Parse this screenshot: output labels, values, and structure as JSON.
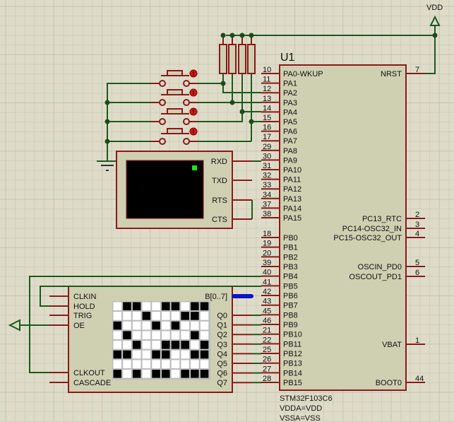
{
  "power": {
    "vdd_label": "VDD"
  },
  "u1": {
    "ref": "U1",
    "part": "STM32F103C6",
    "note1": "VDDA=VDD",
    "note2": "VSSA=VSS",
    "left_pins": [
      {
        "name": "PA0-WKUP",
        "num": "10"
      },
      {
        "name": "PA1",
        "num": "11"
      },
      {
        "name": "PA2",
        "num": "12"
      },
      {
        "name": "PA3",
        "num": "13"
      },
      {
        "name": "PA4",
        "num": "14"
      },
      {
        "name": "PA5",
        "num": "15"
      },
      {
        "name": "PA6",
        "num": "16"
      },
      {
        "name": "PA7",
        "num": "17"
      },
      {
        "name": "PA8",
        "num": "29"
      },
      {
        "name": "PA9",
        "num": "30"
      },
      {
        "name": "PA10",
        "num": "31"
      },
      {
        "name": "PA11",
        "num": "32"
      },
      {
        "name": "PA12",
        "num": "33"
      },
      {
        "name": "PA13",
        "num": "34"
      },
      {
        "name": "PA14",
        "num": "37"
      },
      {
        "name": "PA15",
        "num": "38"
      },
      {
        "name": "PB0",
        "num": "18"
      },
      {
        "name": "PB1",
        "num": "19"
      },
      {
        "name": "PB2",
        "num": "20"
      },
      {
        "name": "PB3",
        "num": "39"
      },
      {
        "name": "PB4",
        "num": "40"
      },
      {
        "name": "PB5",
        "num": "41"
      },
      {
        "name": "PB6",
        "num": "42"
      },
      {
        "name": "PB7",
        "num": "43"
      },
      {
        "name": "PB8",
        "num": "45"
      },
      {
        "name": "PB9",
        "num": "46"
      },
      {
        "name": "PB10",
        "num": "21"
      },
      {
        "name": "PB11",
        "num": "22"
      },
      {
        "name": "PB12",
        "num": "25"
      },
      {
        "name": "PB13",
        "num": "26"
      },
      {
        "name": "PB14",
        "num": "27"
      },
      {
        "name": "PB15",
        "num": "28"
      }
    ],
    "right_pins": [
      {
        "name": "NRST",
        "num": "7",
        "row": 0
      },
      {
        "name": "PC13_RTC",
        "num": "2",
        "row": 15
      },
      {
        "name": "PC14-OSC32_IN",
        "num": "3",
        "row": 16
      },
      {
        "name": "PC15-OSC32_OUT",
        "num": "4",
        "row": 17
      },
      {
        "name": "OSCIN_PD0",
        "num": "5",
        "row": 20
      },
      {
        "name": "OSCOUT_PD1",
        "num": "6",
        "row": 21
      },
      {
        "name": "VBAT",
        "num": "1",
        "row": 28
      },
      {
        "name": "BOOT0",
        "num": "44",
        "row": 32
      }
    ]
  },
  "terminal": {
    "pins": [
      "RXD",
      "TXD",
      "RTS",
      "CTS"
    ]
  },
  "pattern_gen": {
    "left_pins": [
      "CLKIN",
      "HOLD",
      "TRIG",
      "OE",
      "CLKOUT",
      "CASCADE"
    ],
    "bus_label": "B[0..7]",
    "right_pins": [
      "Q0",
      "Q1",
      "Q2",
      "Q3",
      "Q4",
      "Q5",
      "Q6",
      "Q7"
    ],
    "grid": [
      [
        0,
        1,
        1,
        0,
        0,
        1,
        1,
        0,
        1,
        1
      ],
      [
        0,
        0,
        0,
        1,
        0,
        0,
        0,
        1,
        1,
        0
      ],
      [
        1,
        0,
        0,
        0,
        1,
        0,
        1,
        0,
        0,
        0
      ],
      [
        0,
        1,
        0,
        0,
        0,
        0,
        0,
        0,
        1,
        0
      ],
      [
        0,
        0,
        1,
        0,
        0,
        1,
        1,
        1,
        0,
        1
      ],
      [
        1,
        1,
        0,
        0,
        1,
        1,
        0,
        0,
        1,
        1
      ],
      [
        0,
        0,
        0,
        0,
        0,
        0,
        0,
        0,
        0,
        0
      ],
      [
        1,
        0,
        1,
        0,
        1,
        1,
        0,
        1,
        1,
        1
      ]
    ]
  },
  "colors": {
    "wire": "#1d5a1d",
    "pin": "#8b1a1a",
    "bus": "#0a14c8",
    "body": "#cfcfb2",
    "background": "#dedcc9"
  }
}
